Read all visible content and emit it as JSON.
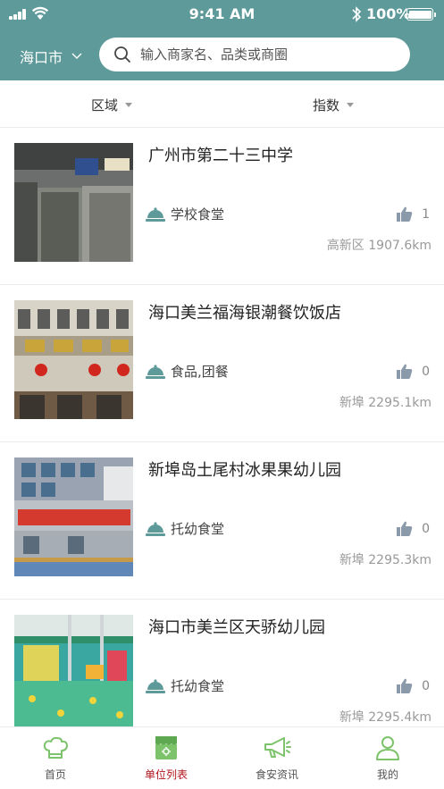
{
  "status_bar": {
    "time": "9:41 AM",
    "battery": "100%"
  },
  "header": {
    "city": "海口市",
    "search_placeholder": "输入商家名、品类或商圈"
  },
  "filters": [
    {
      "label": "区域"
    },
    {
      "label": "指数"
    }
  ],
  "list": [
    {
      "name": "广州市第二十三中学",
      "category": "学校食堂",
      "likes": "1",
      "location": "高新区",
      "distance": "1907.6km"
    },
    {
      "name": "海口美兰福海银潮餐饮饭店",
      "category": "食品,团餐",
      "likes": "0",
      "location": "新埠",
      "distance": "2295.1km"
    },
    {
      "name": "新埠岛土尾村冰果果幼儿园",
      "category": "托幼食堂",
      "likes": "0",
      "location": "新埠",
      "distance": "2295.3km"
    },
    {
      "name": "海口市美兰区天骄幼儿园",
      "category": "托幼食堂",
      "likes": "0",
      "location": "新埠",
      "distance": "2295.4km"
    }
  ],
  "tabs": [
    {
      "label": "首页",
      "icon": "chef-hat-icon"
    },
    {
      "label": "单位列表",
      "icon": "storefront-icon"
    },
    {
      "label": "食安资讯",
      "icon": "megaphone-icon"
    },
    {
      "label": "我的",
      "icon": "user-icon"
    }
  ],
  "colors": {
    "header": "#5e9a9a",
    "accent": "#5e9a9a",
    "active_tab": "#b0141b",
    "icon_green": "#7cc36b"
  }
}
